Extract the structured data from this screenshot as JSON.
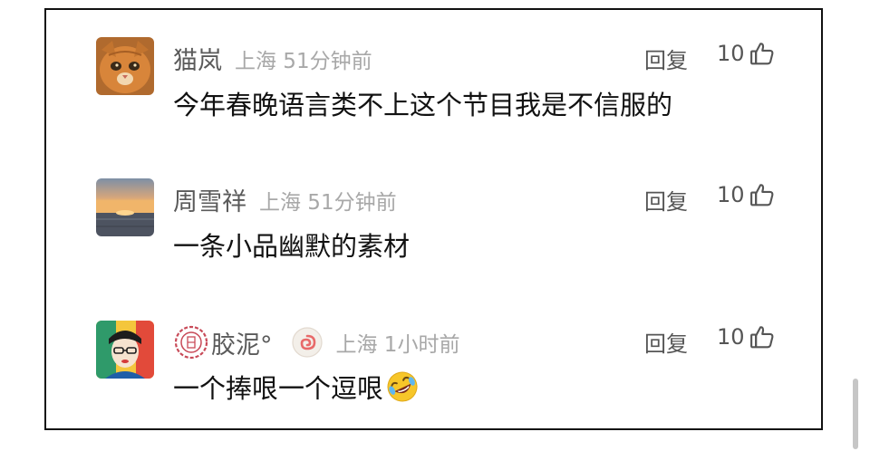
{
  "comments": [
    {
      "username": "猫岚",
      "meta": "上海 51分钟前",
      "reply_label": "回复",
      "likes": "10",
      "text": "今年春晚语言类不上这个节目我是不信服的",
      "avatar_icon": "orange-cat-avatar"
    },
    {
      "username": "周雪祥",
      "meta": "上海 51分钟前",
      "reply_label": "回复",
      "likes": "10",
      "text": "一条小品幽默的素材",
      "avatar_icon": "sunset-sea-avatar"
    },
    {
      "username": "胶泥°",
      "meta": "上海 1小时前",
      "reply_label": "回复",
      "likes": "10",
      "text": "一个捧哏一个逗哏",
      "avatar_icon": "colorful-portrait-avatar",
      "emoji_icon": "rolling-laughing-emoji"
    }
  ],
  "colors": {
    "username": "#5a5a5a",
    "meta": "#a8a8a8",
    "text": "#111111",
    "border": "#111111"
  }
}
